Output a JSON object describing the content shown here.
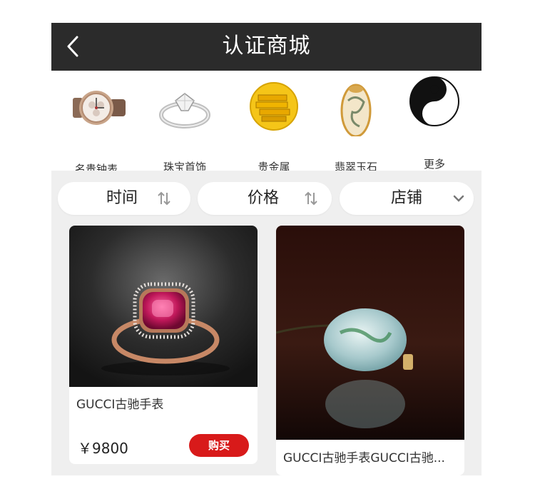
{
  "header": {
    "title": "认证商城"
  },
  "categories": [
    {
      "label": "名贵钟表",
      "icon": "watch-icon"
    },
    {
      "label": "珠宝首饰",
      "icon": "ring-icon"
    },
    {
      "label": "贵金属",
      "icon": "gold-bars-icon"
    },
    {
      "label": "翡翠玉石",
      "icon": "jade-stone-icon"
    },
    {
      "label": "更多",
      "icon": "yin-yang-icon"
    }
  ],
  "filters": [
    {
      "label": "时间",
      "icon": "sort-icon"
    },
    {
      "label": "价格",
      "icon": "sort-icon"
    },
    {
      "label": "店铺",
      "icon": "chevron-down-icon"
    }
  ],
  "products": [
    {
      "name": "GUCCI古驰手表",
      "price": "￥9800",
      "buy_label": "购买",
      "image": "pink-gem-ring"
    },
    {
      "name": "GUCCI古驰手表GUCCI古驰...",
      "image": "jade-pendant"
    }
  ],
  "colors": {
    "header_bg": "#2b2b2b",
    "accent": "#d81a1a",
    "page_bg": "#efefef"
  }
}
